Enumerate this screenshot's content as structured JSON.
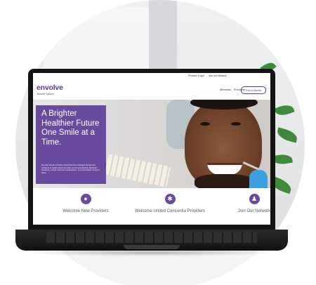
{
  "site": {
    "utility_links": [
      "Provider Login",
      "Join our Network"
    ],
    "logo_text": "envolve",
    "logo_subtext": "Benefit Options",
    "nav_items": [
      "Members",
      "Providers"
    ],
    "find_dentist_label": "Find a Dentist",
    "accent_color": "#6a4a9e"
  },
  "hero": {
    "headline": "A Brighter Healthier Future One Smile at a Time.",
    "body": "Envolve Dental provides comprehensive managed dental care solutions to health plans who offer commercial Dental, Medicaid, Medicare, Health Insurance Marketplace, and dual eligible program plans."
  },
  "features": [
    {
      "label": "Welcome New Providers",
      "icon": "tooth-icon"
    },
    {
      "label": "Welcome United Concordia Providers",
      "icon": "asterisk-icon"
    },
    {
      "label": "Join Our Network",
      "icon": "person-icon"
    }
  ]
}
